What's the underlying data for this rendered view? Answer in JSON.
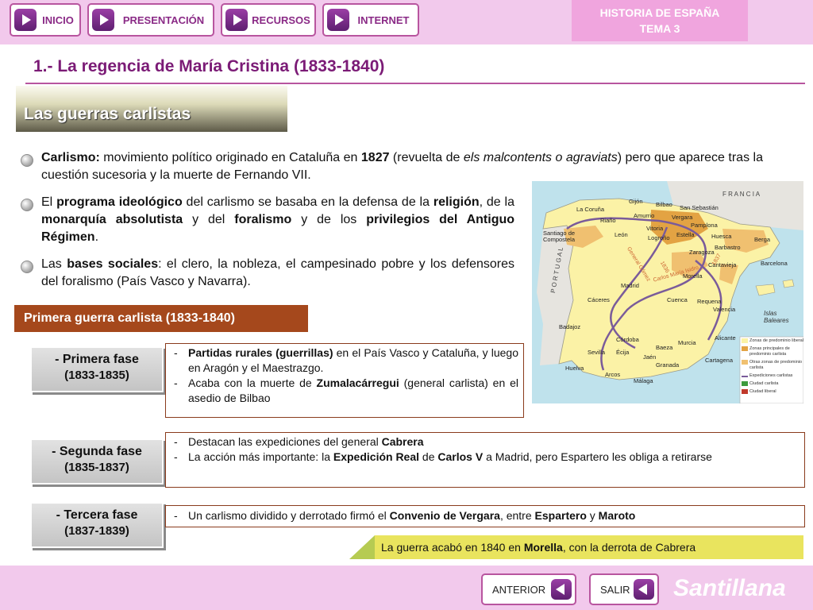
{
  "nav": {
    "inicio": "INICIO",
    "presentacion": "PRESENTACIÓN",
    "recursos": "RECURSOS",
    "internet": "INTERNET"
  },
  "header": {
    "course_line1": "HISTORIA DE ESPAÑA",
    "course_line2": "TEMA 3",
    "title": "1.- La regencia de María Cristina (1833-1840)"
  },
  "section_title": "Las guerras carlistas",
  "para1": {
    "b1": "Carlismo:",
    "t1": " movimiento político originado en Cataluña en ",
    "b2": "1827",
    "t2": " (revuelta de ",
    "i1": "els malcontents o agraviats",
    "t3": ") pero que aparece tras la cuestión sucesoria y la muerte de Fernando VII."
  },
  "para2": {
    "t1": "El ",
    "b1": "programa ideológico",
    "t2": " del carlismo se basaba en la defensa de la ",
    "b2": "religión",
    "t3": ", de la ",
    "b3": "monarquía absolutista",
    "t4": " y del ",
    "b4": "foralismo",
    "t5": " y de los ",
    "b5": "privilegios del Antiguo Régimen",
    "t6": "."
  },
  "para3": {
    "t1": "Las ",
    "b1": "bases sociales",
    "t2": ": el clero, la nobleza, el campesinado pobre y los defensores del foralismo (País Vasco y Navarra)."
  },
  "map": {
    "country_fr": "F R A N C I A",
    "country_pt": "P O R T U G A L",
    "cities": [
      "Gijón",
      "La Coruña",
      "Bilbao",
      "San Sebastián",
      "Riaño",
      "Amurrio",
      "Vergara",
      "Pamplona",
      "Santiago de Compostela",
      "León",
      "Vitoria",
      "Estella",
      "Huesca",
      "Berga",
      "Logroño",
      "Barbastro",
      "Zaragoza",
      "Barcelona",
      "Cantavieja",
      "Madrid",
      "Morella",
      "Cuenca",
      "Requena",
      "Valencia",
      "Cáceres",
      "Badajoz",
      "Córdoba",
      "Baeza",
      "Murcia",
      "Alicante",
      "Sevilla",
      "Écija",
      "Jaén",
      "Granada",
      "Cartagena",
      "Huelva",
      "Arcos",
      "Málaga"
    ],
    "islands": "Islas Baleares",
    "route1": "General Gómez",
    "route2": "Carlos María Isidro",
    "year1": "1836",
    "year2": "1837",
    "legend": [
      "Zonas de predominio liberal",
      "Zonas principales de predominio carlista",
      "Otras zonas de predominio carlista",
      "Expediciones carlistas",
      "Ciudad carlista",
      "Ciudad liberal"
    ]
  },
  "subhead": "Primera guerra carlista (1833-1840)",
  "phases": [
    {
      "name": "- Primera fase",
      "years": "(1833-1835)"
    },
    {
      "name": "- Segunda fase",
      "years": "(1835-1837)"
    },
    {
      "name": "- Tercera fase",
      "years": "(1837-1839)"
    }
  ],
  "phase1_box": {
    "li1": {
      "b1": "Partidas rurales (guerrillas)",
      "t1": " en el País Vasco y Cataluña, y luego en Aragón y el Maestrazgo."
    },
    "li2": {
      "t1": "Acaba con la muerte de ",
      "b1": "Zumalacárregui",
      "t2": " (general carlista) en el asedio de Bilbao"
    }
  },
  "phase2_box": {
    "li1": {
      "t1": "Destacan las expediciones del general ",
      "b1": "Cabrera"
    },
    "li2": {
      "t1": "La acción más importante: la ",
      "b1": "Expedición Real",
      "t2": " de ",
      "b2": "Carlos V",
      "t3": " a Madrid, pero Espartero les obliga a retirarse"
    }
  },
  "phase3_box": {
    "li1": {
      "t1": "Un carlismo dividido y derrotado firmó el ",
      "b1": "Convenio de Vergara",
      "t2": ", entre ",
      "b2": "Espartero",
      "t3": " y ",
      "b3": "Maroto"
    }
  },
  "conclusion": {
    "t1": "La guerra acabó en 1840 en ",
    "b1": "Morella",
    "t2": ", con la derrota de Cabrera"
  },
  "footer": {
    "anterior": "ANTERIOR",
    "salir": "SALIR",
    "brand": "Santillana"
  },
  "colors": {
    "accent": "#7b1b76",
    "bar": "#f2c9ec",
    "subhead": "#a5481c",
    "conclusion": "#e9e45e"
  }
}
